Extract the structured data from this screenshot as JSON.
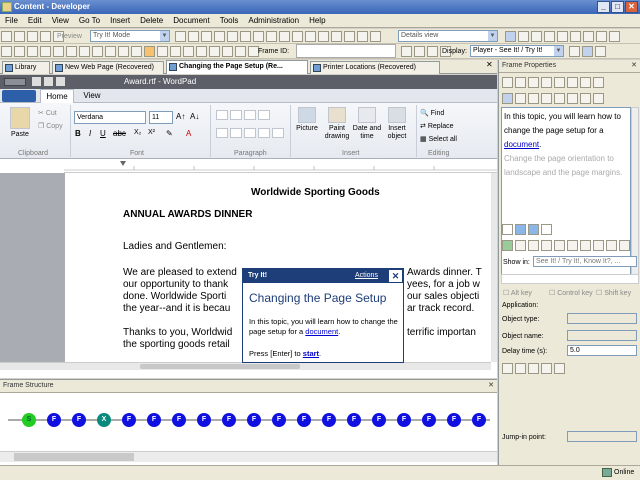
{
  "window": {
    "title": "Content - Developer"
  },
  "menu": [
    "File",
    "Edit",
    "View",
    "Go To",
    "Insert",
    "Delete",
    "Document",
    "Tools",
    "Administration",
    "Help"
  ],
  "toolbar1": {
    "preview_label": "Preview",
    "mode_value": "Try It! Mode",
    "view_value": "Details view"
  },
  "toolbar2": {
    "frame_id_label": "Frame ID:",
    "display_label": "Display:",
    "display_value": "Player - See It! / Try It!"
  },
  "tabs": [
    {
      "label": "Library"
    },
    {
      "label": "New Web Page (Recovered)"
    },
    {
      "label": "Changing the Page Setup (Re..."
    },
    {
      "label": "Printer Locations (Recovered)"
    }
  ],
  "wordpad": {
    "title": "Award.rtf - WordPad",
    "tab_home": "Home",
    "tab_view": "View",
    "paste": "Paste",
    "cut": "Cut",
    "copy": "Copy",
    "font_name": "Verdana",
    "font_size": "11",
    "groups": {
      "clipboard": "Clipboard",
      "font": "Font",
      "paragraph": "Paragraph",
      "insert": "Insert",
      "editing": "Editing"
    },
    "insert_items": [
      "Picture",
      "Paint drawing",
      "Date and time",
      "Insert object"
    ],
    "editing_items": [
      "Find",
      "Replace",
      "Select all"
    ],
    "doc": {
      "heading": "Worldwide Sporting Goods",
      "subheading": "ANNUAL AWARDS DINNER",
      "greeting": "Ladies and Gentlemen:",
      "p1a": "We are pleased to extend",
      "p1a_end": "Awards dinner.  T",
      "p1b": "our opportunity to thank",
      "p1b_end": "yees, for a job w",
      "p1c": "done.  Worldwide Sporti",
      "p1c_end": "our sales objecti",
      "p1d": "the year--and it is becau",
      "p1d_end": "ar track record.",
      "p2a": "Thanks to you, Worldwid",
      "p2a_end": "terrific importan",
      "p2b": "the sporting goods retail"
    }
  },
  "callout": {
    "header": "Try It!",
    "actions": "Actions",
    "title": "Changing the Page Setup",
    "body_pre": "In this topic, you will learn how to change the page setup for a ",
    "body_link": "document",
    "body_post": ".",
    "footer_pre": "Press [Enter] to ",
    "footer_link": "start",
    "footer_post": "."
  },
  "frame_properties": {
    "title": "Frame Properties",
    "text1_pre": "In this topic, you will learn how to change the page setup for a ",
    "text1_link": "document",
    "text1_post": ".",
    "text2": "Change the page orientation to landscape and the page margins.",
    "show_in_label": "Show in:",
    "show_in_value": "See It! / Try It!, Know It?, ...",
    "alt_key": "Alt key",
    "control_key": "Control key",
    "shift_key": "Shift key",
    "application": "Application:",
    "object_type": "Object type:",
    "object_name": "Object name:",
    "delay_time": "Delay time (s):",
    "delay_value": "5.0",
    "jump_in": "Jump-in point:"
  },
  "frame_structure": {
    "title": "Frame Structure",
    "nodes": [
      "S",
      "F",
      "F",
      "X",
      "F",
      "F",
      "F",
      "F",
      "F",
      "F",
      "F",
      "F",
      "F",
      "F",
      "F",
      "F",
      "F",
      "F",
      "F"
    ]
  },
  "status": {
    "online": "Online"
  },
  "colors": {
    "node_start": "#22cc22",
    "node_frame": "#1010e0",
    "node_x": "#0a8a7a",
    "accent": "#1e3e7a",
    "link": "#0000cc"
  }
}
